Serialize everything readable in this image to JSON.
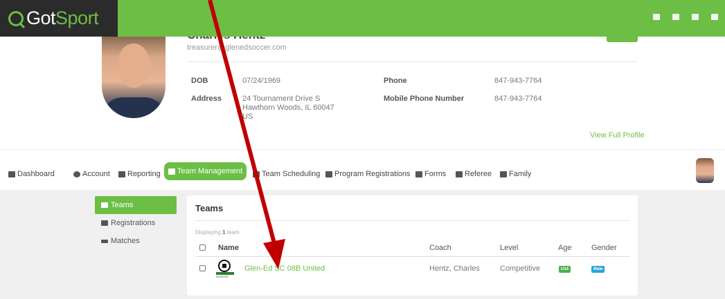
{
  "app": {
    "logo_got": "Got",
    "logo_sport": "Sport",
    "top_icons": [
      "grid-icon",
      "user-icon",
      "mail-icon",
      "apps-icon"
    ]
  },
  "profile": {
    "name": "Charles Hentz",
    "email": "treasurer@glenedsoccer.com",
    "dob_label": "DOB",
    "dob_value": "07/24/1969",
    "address_label": "Address",
    "address_line1": "24 Tournament Drive S",
    "address_line2": "Hawthorn Woods, IL 60047",
    "address_line3": "US",
    "phone_label": "Phone",
    "phone_value": "847-943-7764",
    "mobile_label": "Mobile Phone Number",
    "mobile_value": "847-943-7764",
    "view_full_profile": "View Full Profile"
  },
  "nav": {
    "items": [
      {
        "label": "Dashboard",
        "icon": "dashboard-icon"
      },
      {
        "label": "Account",
        "icon": "account-icon"
      },
      {
        "label": "Reporting",
        "icon": "reporting-icon"
      },
      {
        "label": "Team Management",
        "icon": "team-icon",
        "active": true
      },
      {
        "label": "Team Scheduling",
        "icon": "scheduling-icon"
      },
      {
        "label": "Program Registrations",
        "icon": "paper-plane-icon"
      },
      {
        "label": "Forms",
        "icon": "forms-icon"
      },
      {
        "label": "Referee",
        "icon": "calendar-icon"
      },
      {
        "label": "Family",
        "icon": "family-icon"
      }
    ]
  },
  "sidebar": {
    "items": [
      {
        "label": "Teams",
        "icon": "team-icon",
        "active": true
      },
      {
        "label": "Registrations",
        "icon": "registrations-icon"
      },
      {
        "label": "Matches",
        "icon": "exchange-icon"
      }
    ]
  },
  "teams": {
    "title": "Teams",
    "displaying_prefix": "Displaying ",
    "displaying_count": "1",
    "displaying_suffix": " team",
    "columns": {
      "name": "Name",
      "coach": "Coach",
      "level": "Level",
      "age": "Age",
      "gender": "Gender"
    },
    "rows": [
      {
        "name": "Glen-Ed SC 08B United",
        "logo_caption": "GLEN-ED",
        "coach": "Hentz, Charles",
        "level": "Competitive",
        "age": "U14",
        "gender": "Male"
      }
    ]
  },
  "colors": {
    "brand_green": "#6cbe45",
    "logo_bg": "#2b2b2b",
    "annotation_arrow": "#c00000",
    "age_badge": "#4caf50",
    "gender_badge": "#29a3d9"
  }
}
